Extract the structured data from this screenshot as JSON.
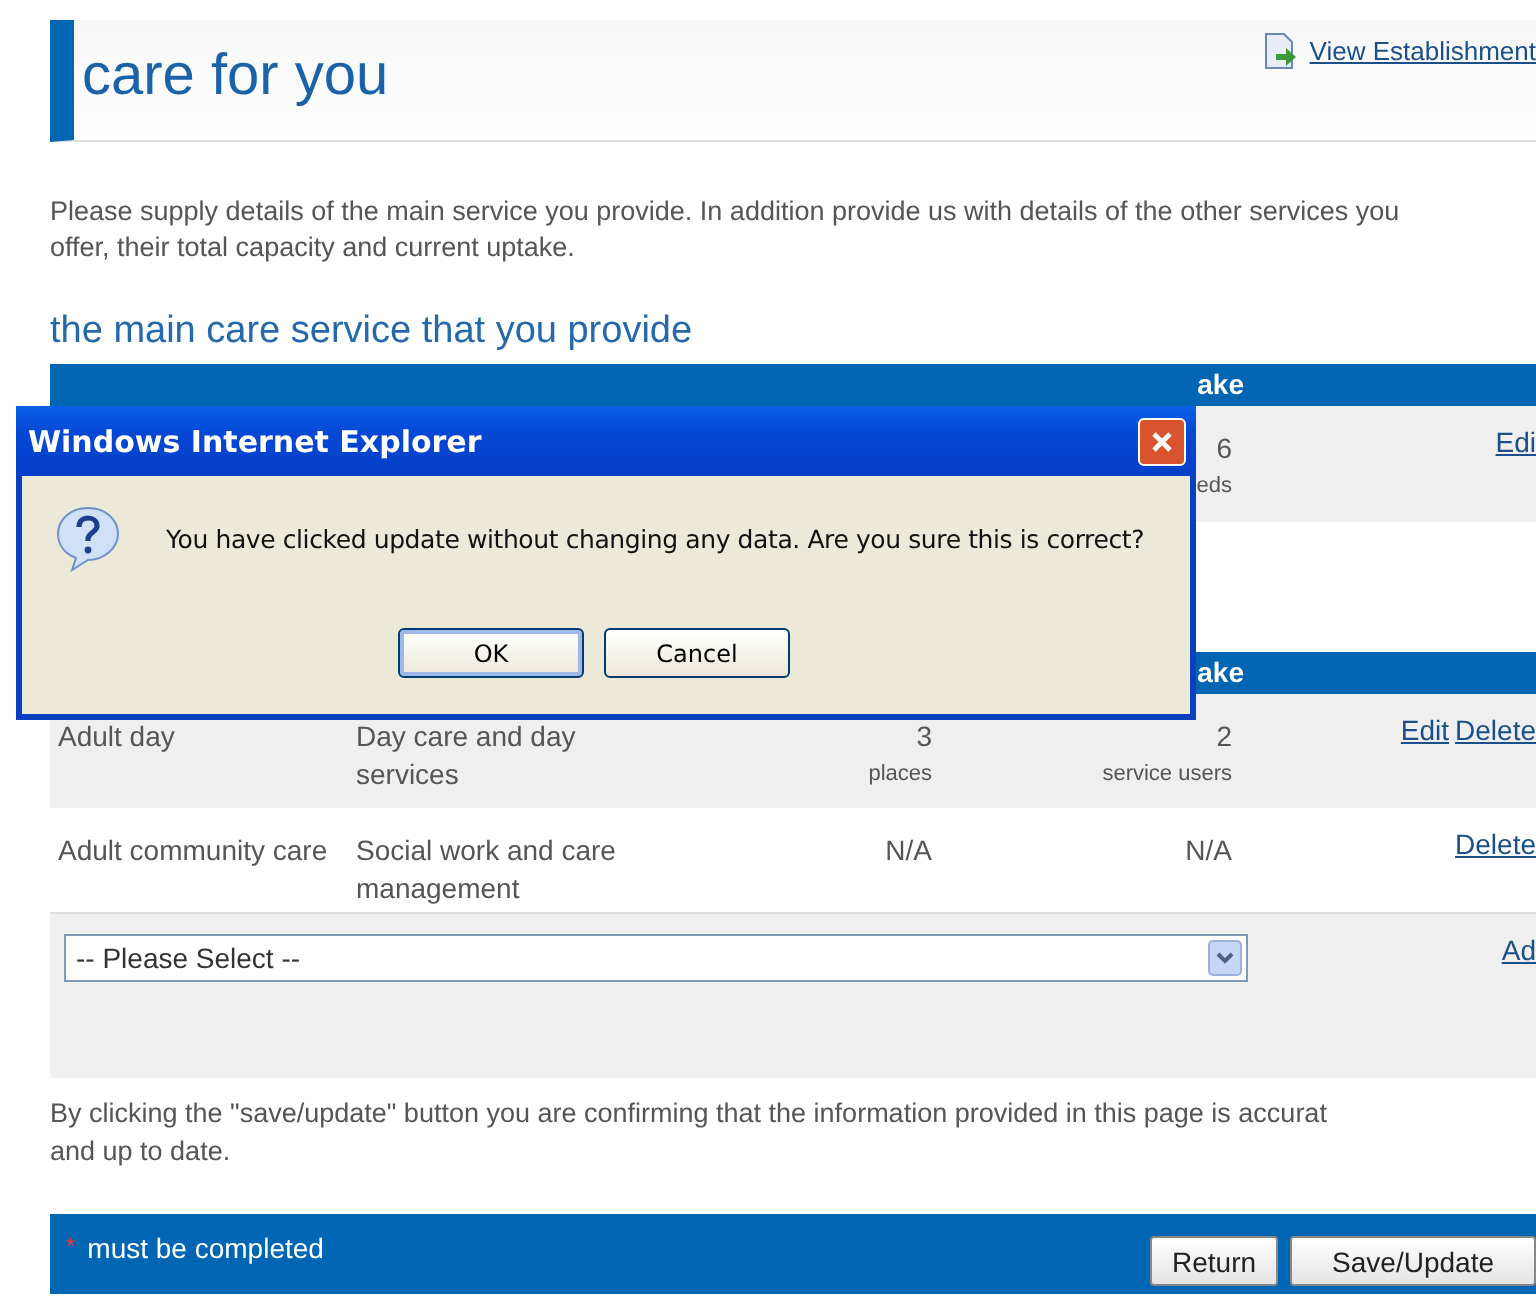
{
  "header": {
    "title": "care for you",
    "link": "View Establishment"
  },
  "intro": "Please supply details of the main service you provide. In addition provide us with details of the other services you offer, their total capacity and current uptake.",
  "main_section": {
    "heading": "the main care service that you provide",
    "header_visible": "ake",
    "rows": [
      {
        "uptake": "6",
        "uptake_unit": "eds",
        "actions": [
          "Edi"
        ]
      }
    ]
  },
  "other_section": {
    "header_visible": "ake",
    "rows": [
      {
        "type": "Adult day",
        "service": "Day care and day services",
        "capacity": "3",
        "capacity_unit": "places",
        "uptake": "2",
        "uptake_unit": "service users",
        "actions": [
          "Edit",
          "Delete"
        ]
      },
      {
        "type": "Adult community care",
        "service": "Social work and care management",
        "capacity": "N/A",
        "uptake": "N/A",
        "actions": [
          "Delete"
        ]
      }
    ],
    "select": {
      "value": "-- Please Select --"
    },
    "add_link": "Ad"
  },
  "confirmation": "By clicking the \"save/update\" button you are confirming that the information provided in this page is accurat\nand up to date.",
  "footer": {
    "required_mark": "*",
    "note": "must be completed",
    "buttons": [
      "Return",
      "Save/Update"
    ]
  },
  "dialog": {
    "title": "Windows Internet Explorer",
    "message": "You have clicked update without changing any data. Are you sure this is correct?",
    "buttons": [
      "OK",
      "Cancel"
    ]
  }
}
